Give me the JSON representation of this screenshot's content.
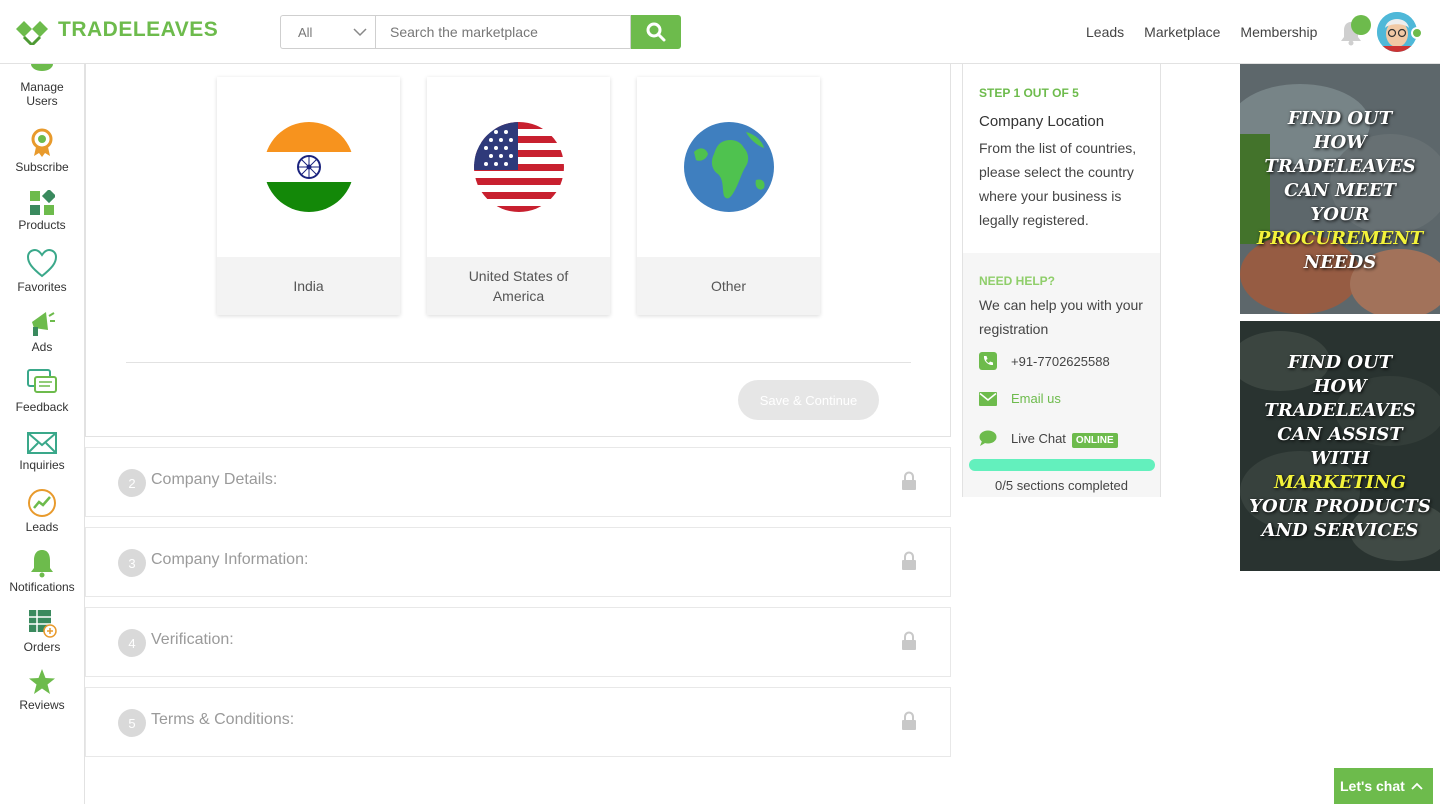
{
  "brand": {
    "name": "TRADELEAVES"
  },
  "search": {
    "category": "All",
    "placeholder": "Search the marketplace"
  },
  "topnav": [
    "Leads",
    "Marketplace",
    "Membership"
  ],
  "sidebar": [
    {
      "label_lines": [
        "Manage",
        "Users"
      ],
      "icon": "users-icon"
    },
    {
      "label_lines": [
        "Subscribe"
      ],
      "icon": "medal-icon"
    },
    {
      "label_lines": [
        "Products"
      ],
      "icon": "products-icon"
    },
    {
      "label_lines": [
        "Favorites"
      ],
      "icon": "heart-icon"
    },
    {
      "label_lines": [
        "Ads"
      ],
      "icon": "megaphone-icon"
    },
    {
      "label_lines": [
        "Feedback"
      ],
      "icon": "feedback-icon"
    },
    {
      "label_lines": [
        "Inquiries"
      ],
      "icon": "envelope-icon"
    },
    {
      "label_lines": [
        "Leads"
      ],
      "icon": "leads-icon"
    },
    {
      "label_lines": [
        "Notifications"
      ],
      "icon": "bell-icon"
    },
    {
      "label_lines": [
        "Orders"
      ],
      "icon": "orders-icon"
    },
    {
      "label_lines": [
        "Reviews"
      ],
      "icon": "star-icon"
    }
  ],
  "countries": [
    {
      "name": "India",
      "flag": "india-flag-icon"
    },
    {
      "name": "United States of America",
      "flag": "usa-flag-icon"
    },
    {
      "name": "Other",
      "flag": "globe-icon"
    }
  ],
  "save_label": "Save & Continue",
  "steps": [
    {
      "num": "2",
      "title": "Company Details:"
    },
    {
      "num": "3",
      "title": "Company Information:"
    },
    {
      "num": "4",
      "title": "Verification:"
    },
    {
      "num": "5",
      "title": "Terms & Conditions:"
    }
  ],
  "help": {
    "step_label": "STEP 1 OUT OF 5",
    "title": "Company Location",
    "description": "From the list of countries, please select the country where your business is legally registered.",
    "need_help": "NEED HELP?",
    "can_help": "We can help you with your registration",
    "phone": "+91-7702625588",
    "email_label": "Email us",
    "live_chat": "Live Chat",
    "online_badge": "ONLINE",
    "progress_fraction": 0,
    "progress_text": "0/5 sections completed"
  },
  "ads": [
    {
      "lines": [
        "FIND OUT",
        "HOW",
        "TRADELEAVES",
        "CAN MEET",
        "YOUR"
      ],
      "highlight": "PROCUREMENT",
      "tail": [
        "NEEDS"
      ]
    },
    {
      "lines": [
        "FIND OUT",
        "HOW",
        "TRADELEAVES",
        "CAN ASSIST",
        "WITH"
      ],
      "highlight": "MARKETING",
      "tail": [
        "YOUR PRODUCTS",
        "AND SERVICES"
      ]
    }
  ],
  "chat_button": "Let's chat",
  "colors": {
    "brand_green": "#6dbb4c",
    "accent_mint": "#63f0bd"
  }
}
